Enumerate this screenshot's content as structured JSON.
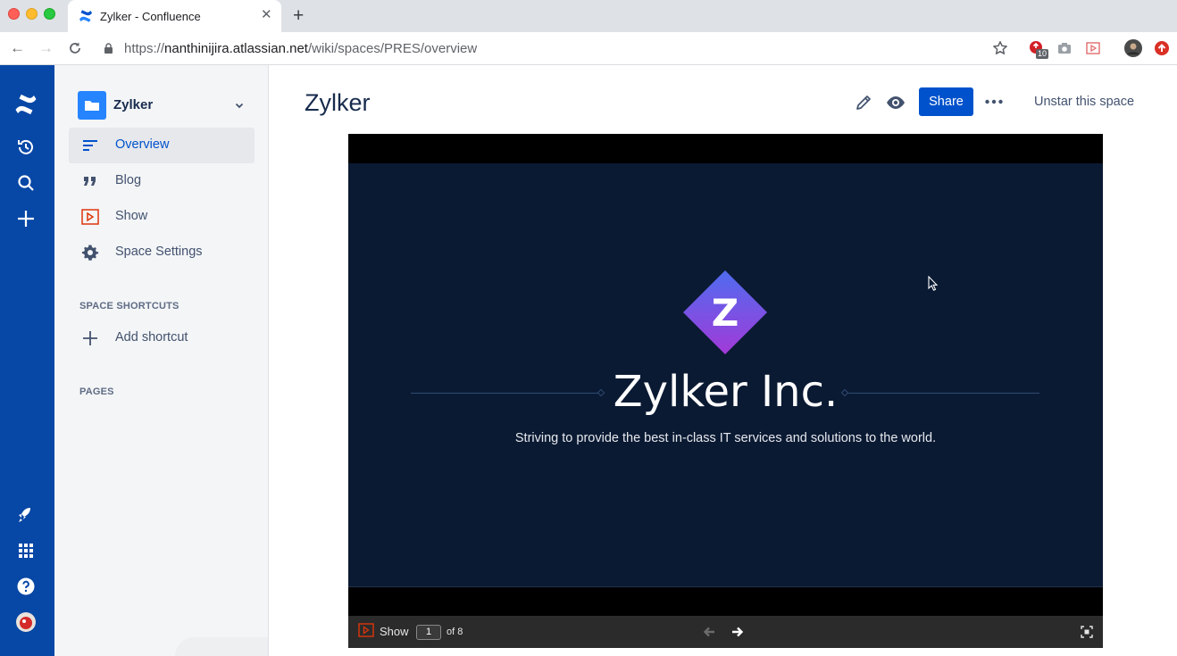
{
  "browser": {
    "tab_title": "Zylker - Confluence",
    "url_scheme": "https://",
    "url_host": "nanthinijira.atlassian.net",
    "url_path": "/wiki/spaces/PRES/overview",
    "extension_badge": "10"
  },
  "sidebar": {
    "space_name": "Zylker",
    "items": [
      {
        "label": "Overview",
        "icon": "overview-icon",
        "active": true
      },
      {
        "label": "Blog",
        "icon": "quote-icon",
        "active": false
      },
      {
        "label": "Show",
        "icon": "presentation-icon",
        "active": false
      },
      {
        "label": "Space Settings",
        "icon": "gear-icon",
        "active": false
      }
    ],
    "shortcuts_heading": "SPACE SHORTCUTS",
    "add_shortcut_label": "Add shortcut",
    "pages_heading": "PAGES"
  },
  "header": {
    "title": "Zylker",
    "share_label": "Share",
    "unstar_label": "Unstar this space"
  },
  "presentation": {
    "logo_letter": "Z",
    "slide_title": "Zylker Inc.",
    "slide_subtitle": "Striving to provide the best in-class IT services and solutions to the world.",
    "show_label": "Show",
    "current_page": "1",
    "page_total_label": "of 8"
  },
  "colors": {
    "global_nav": "#0747a6",
    "primary": "#0052cc",
    "slide_bg": "#0b1a33",
    "logo_top": "#4f6cf0",
    "logo_bottom": "#a23ad8"
  }
}
